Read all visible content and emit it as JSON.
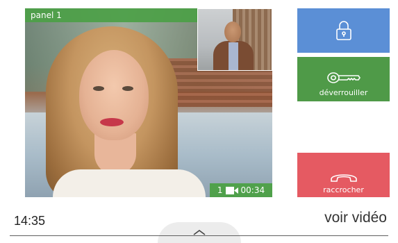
{
  "video": {
    "panel_label": "panel 1",
    "camera_index": "1",
    "call_duration": "00:34"
  },
  "actions": {
    "lock_label": "",
    "unlock_label": "déverrouiller",
    "hangup_label": "raccrocher"
  },
  "footer": {
    "time": "14:35",
    "show_video_label": "voir vidéo"
  },
  "colors": {
    "lock_button": "#5b8fd6",
    "unlock_button": "#4f9a48",
    "hangup_button": "#e55a62",
    "overlay_green": "#4ca046"
  },
  "icons": {
    "lock": "padlock-icon",
    "unlock": "key-icon",
    "hangup": "phone-hangup-icon",
    "camera": "video-camera-icon",
    "handle": "chevron-up-icon"
  }
}
